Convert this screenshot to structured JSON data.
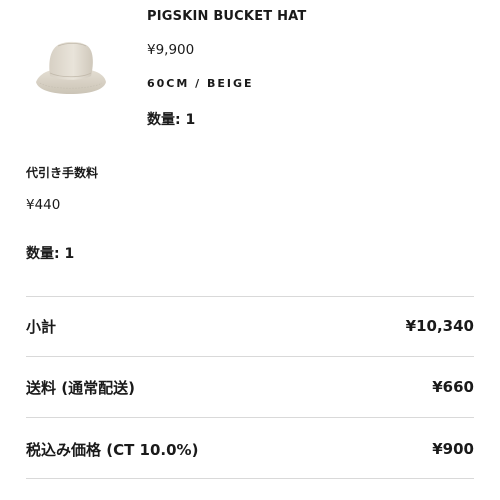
{
  "product": {
    "name": "PIGSKIN BUCKET HAT",
    "price": "¥9,900",
    "variant": "60CM / BEIGE",
    "quantity": "数量: 1",
    "image_icon": "bucket-hat-image"
  },
  "fee": {
    "name": "代引き手数料",
    "price": "¥440",
    "quantity": "数量: 1"
  },
  "summary": {
    "subtotal": {
      "label": "小計",
      "value": "¥10,340"
    },
    "shipping": {
      "label": "送料 (通常配送)",
      "value": "¥660"
    },
    "tax": {
      "label": "税込み価格 (CT 10.0%)",
      "value": "¥900"
    }
  },
  "colors": {
    "text": "#1a1a1a",
    "divider": "#d9d9d9",
    "hat": "#e3ddd2"
  }
}
